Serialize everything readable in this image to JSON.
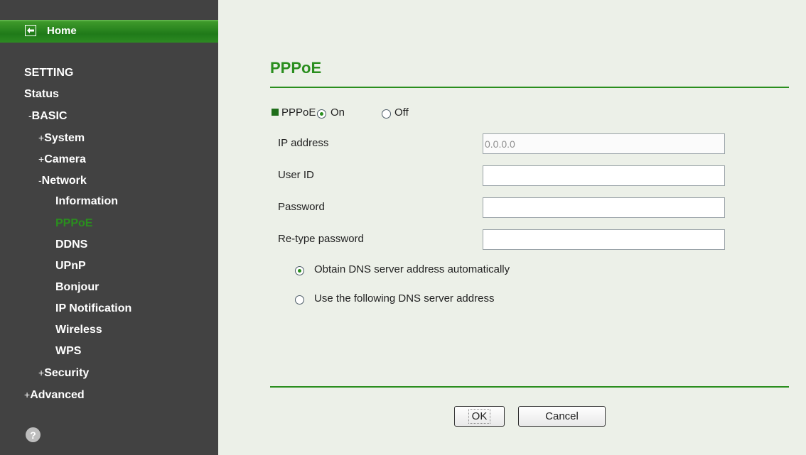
{
  "sidebar": {
    "home_label": "Home",
    "items": [
      {
        "prefix": "",
        "label": "SETTING"
      },
      {
        "prefix": "",
        "label": "Status"
      },
      {
        "prefix": "-",
        "label": "BASIC"
      },
      {
        "prefix": "+",
        "label": "System"
      },
      {
        "prefix": "+",
        "label": "Camera"
      },
      {
        "prefix": "-",
        "label": "Network"
      },
      {
        "prefix": "",
        "label": "Information"
      },
      {
        "prefix": "",
        "label": "PPPoE"
      },
      {
        "prefix": "",
        "label": "DDNS"
      },
      {
        "prefix": "",
        "label": "UPnP"
      },
      {
        "prefix": "",
        "label": "Bonjour"
      },
      {
        "prefix": "",
        "label": "IP Notification"
      },
      {
        "prefix": "",
        "label": "Wireless"
      },
      {
        "prefix": "",
        "label": "WPS"
      },
      {
        "prefix": "+",
        "label": "Security"
      },
      {
        "prefix": "+",
        "label": "Advanced"
      }
    ],
    "help_icon": "?"
  },
  "main": {
    "title": "PPPoE",
    "pppoe_label": "PPPoE",
    "on_label": "On",
    "off_label": "Off",
    "pppoe_enabled": "On",
    "fields": {
      "ip_address": {
        "label": "IP address",
        "value": "0.0.0.0"
      },
      "user_id": {
        "label": "User ID",
        "value": ""
      },
      "password": {
        "label": "Password",
        "value": ""
      },
      "retype_password": {
        "label": "Re-type password",
        "value": ""
      }
    },
    "dns_auto_label": "Obtain DNS server address automatically",
    "dns_manual_label": "Use the following DNS server address",
    "dns_mode": "auto",
    "ok_label": "OK",
    "cancel_label": "Cancel"
  },
  "colors": {
    "accent": "#2a8e1e",
    "sidebar_bg": "#424242",
    "content_bg": "#ecf0e8"
  }
}
